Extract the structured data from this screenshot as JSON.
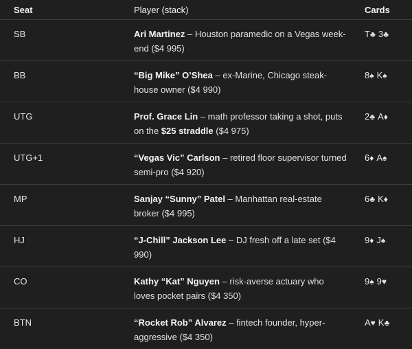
{
  "headers": {
    "seat": "Seat",
    "player": "Player (stack)",
    "cards": "Cards"
  },
  "rows": [
    {
      "seat": "SB",
      "name": "Ari Martinez",
      "desc": " – Houston paramedic on a Vegas week-end ",
      "desc_strong": "",
      "desc_tail": "",
      "stack": "($4 995)",
      "cards": [
        {
          "rank": "T",
          "suit": "♣"
        },
        {
          "rank": "3",
          "suit": "♣"
        }
      ]
    },
    {
      "seat": "BB",
      "name": "“Big Mike” O’Shea",
      "desc": " – ex-Marine, Chicago steak-house owner ",
      "desc_strong": "",
      "desc_tail": "",
      "stack": "($4 990)",
      "cards": [
        {
          "rank": "8",
          "suit": "♠"
        },
        {
          "rank": "K",
          "suit": "♠"
        }
      ]
    },
    {
      "seat": "UTG",
      "name": "Prof. Grace Lin",
      "desc": " – math professor taking a shot, puts on the ",
      "desc_strong": "$25 straddle",
      "desc_tail": " ",
      "stack": "($4 975)",
      "cards": [
        {
          "rank": "2",
          "suit": "♣"
        },
        {
          "rank": "A",
          "suit": "♦"
        }
      ]
    },
    {
      "seat": "UTG+1",
      "name": "“Vegas Vic” Carlson",
      "desc": " – retired floor supervisor turned semi-pro ",
      "desc_strong": "",
      "desc_tail": "",
      "stack": "($4 920)",
      "cards": [
        {
          "rank": "6",
          "suit": "♦"
        },
        {
          "rank": "A",
          "suit": "♠"
        }
      ]
    },
    {
      "seat": "MP",
      "name": "Sanjay “Sunny” Patel",
      "desc": " – Manhattan real-estate broker ",
      "desc_strong": "",
      "desc_tail": "",
      "stack": "($4 995)",
      "cards": [
        {
          "rank": "6",
          "suit": "♣"
        },
        {
          "rank": "K",
          "suit": "♦"
        }
      ]
    },
    {
      "seat": "HJ",
      "name": "“J-Chill” Jackson Lee",
      "desc": " – DJ fresh off a late set ",
      "desc_strong": "",
      "desc_tail": "",
      "stack": "($4 990)",
      "cards": [
        {
          "rank": "9",
          "suit": "♦"
        },
        {
          "rank": "J",
          "suit": "♠"
        }
      ]
    },
    {
      "seat": "CO",
      "name": "Kathy “Kat” Nguyen",
      "desc": " – risk-averse actuary who loves pocket pairs ",
      "desc_strong": "",
      "desc_tail": "",
      "stack": "($4 350)",
      "cards": [
        {
          "rank": "9",
          "suit": "♠"
        },
        {
          "rank": "9",
          "suit": "♥"
        }
      ]
    },
    {
      "seat": "BTN",
      "name": "“Rocket Rob” Alvarez",
      "desc": " – fintech founder, hyper-aggressive ",
      "desc_strong": "",
      "desc_tail": "",
      "stack": "($4 350)",
      "cards": [
        {
          "rank": "A",
          "suit": "♥"
        },
        {
          "rank": "K",
          "suit": "♣"
        }
      ]
    }
  ]
}
